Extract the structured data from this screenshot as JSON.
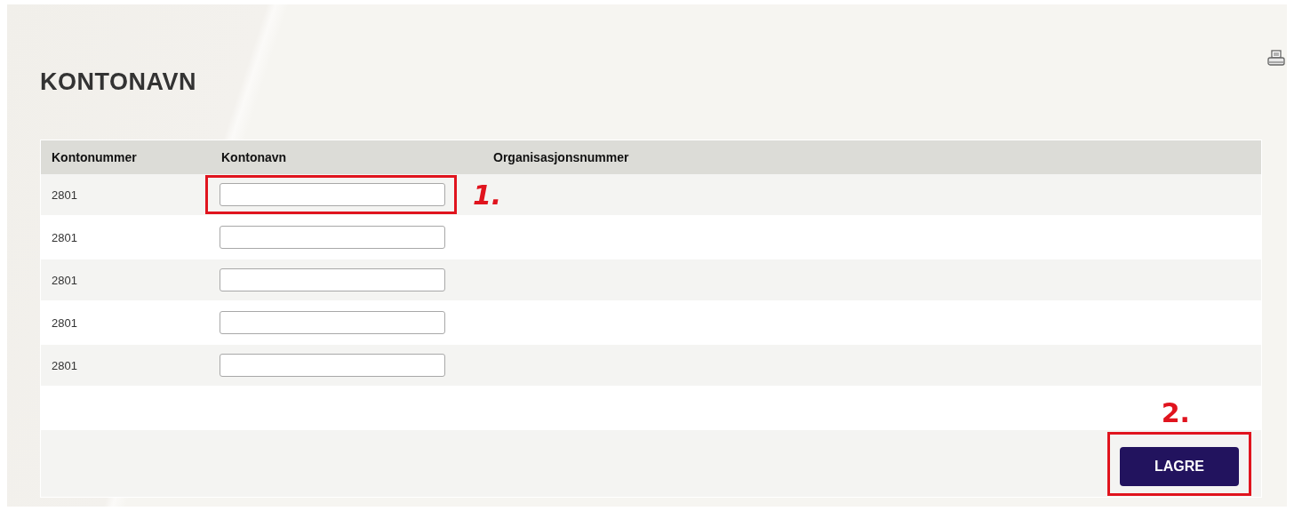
{
  "page": {
    "title": "KONTONAVN"
  },
  "table": {
    "columns": [
      "Kontonummer",
      "Kontonavn",
      "Organisasjonsnummer"
    ],
    "rows": [
      {
        "account": "2801",
        "highlighted": true,
        "callout": "1."
      },
      {
        "account": "2801",
        "highlighted": false
      },
      {
        "account": "2801",
        "highlighted": false
      },
      {
        "account": "2801",
        "highlighted": false
      },
      {
        "account": "2801",
        "highlighted": false
      }
    ]
  },
  "save_button": {
    "label": "LAGRE",
    "highlighted": true,
    "callout": "2."
  }
}
